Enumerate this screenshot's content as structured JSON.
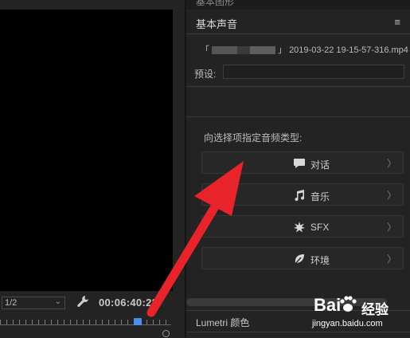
{
  "monitor": {
    "resolution": "1/2",
    "timecode": "00:06:40:22"
  },
  "panel": {
    "prev_tab": "基本图形",
    "title": "基本声音",
    "menu_glyph": "≡",
    "clip_prefix": "「",
    "clip_suffix": "」",
    "clip_name": "2019-03-22 19-15-57-316.mp4",
    "preset_label": "预设:",
    "assign_prompt": "向选择项指定音频类型:",
    "buttons": [
      {
        "label": "对话",
        "icon": "speech-bubble-icon"
      },
      {
        "label": "音乐",
        "icon": "music-note-icon"
      },
      {
        "label": "SFX",
        "icon": "burst-icon"
      },
      {
        "label": "环境",
        "icon": "leaf-icon"
      }
    ],
    "chevron": "〉",
    "lumetri": "Lumetri 颜色"
  },
  "watermark": {
    "brand_bai": "Bai",
    "brand_jy": "经验",
    "url": "jingyan.baidu.com"
  },
  "colors": {
    "accent_arrow": "#e8232a",
    "playhead": "#4b8ff0",
    "background": "#232323"
  }
}
